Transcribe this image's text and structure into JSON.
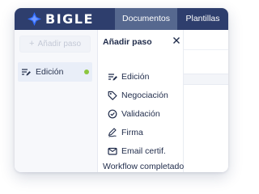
{
  "app": {
    "brand": "BIGLE",
    "colors": {
      "topbar": "#2e3e6d",
      "active_tab": "#56688f",
      "selected_item_bg": "#e9eef8",
      "status_dot": "#8cc63f",
      "logo_blue": "#2f6bff"
    }
  },
  "nav": {
    "tabs": [
      {
        "label": "Documentos",
        "active": true
      },
      {
        "label": "Plantillas",
        "active": false
      }
    ]
  },
  "sidebar": {
    "add_step_label": "Añadir paso",
    "add_step_icon": "plus-icon",
    "items": [
      {
        "label": "Edición",
        "icon": "edit-lines-icon",
        "status_dot": true
      }
    ]
  },
  "panel": {
    "title": "Añadir paso",
    "close_icon": "close-icon",
    "options": [
      {
        "label": "Edición",
        "icon": "edit-lines-icon"
      },
      {
        "label": "Negociación",
        "icon": "tag-icon"
      },
      {
        "label": "Validación",
        "icon": "check-circle-icon"
      },
      {
        "label": "Firma",
        "icon": "signature-pen-icon"
      },
      {
        "label": "Email certif.",
        "icon": "email-icon"
      }
    ],
    "final_option": "Workflow completado"
  }
}
